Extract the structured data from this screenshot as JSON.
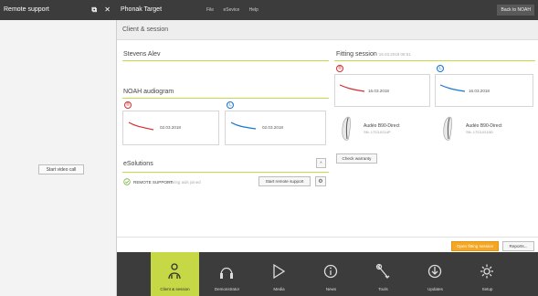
{
  "left_panel": {
    "title": "Remote support",
    "title_icons": "⧉ ✕",
    "start_video_label": "Start video call"
  },
  "app": {
    "title": "Phonak Target",
    "menu": [
      "File",
      "eSevice",
      "Help"
    ],
    "back_noah": "Back to NOAH",
    "subheader": "Client & session",
    "client_name": "Stevens Alev",
    "noah_audiogram": "NOAH audiogram",
    "audiogram_right_date": "02.03.2018",
    "audiogram_left_date": "02.03.2018",
    "fitting_session_label": "Fitting session",
    "fitting_session_datetime": "16.03.2018 08:51",
    "fitting_right_date": "16.03.2018",
    "fitting_left_date": "16.03.2018",
    "device_right_name": "Audéo B90-Direct",
    "device_right_sn": "SN: 1723-0214P",
    "device_left_name": "Audéo B90-Direct",
    "device_left_sn": "SN: 1723-0215D",
    "check_warranty": "Check warranty",
    "esolutions": "eSolutions",
    "remote_support": "REMOTE SUPPORT",
    "remote_support_status": "Hearing aids joined",
    "start_remote_support": "Start remote support",
    "open_fitting_session": "Open fitting session",
    "reports": "Reports..."
  },
  "nav": [
    {
      "label": "Client & session",
      "icon": "person-icon",
      "active": true
    },
    {
      "label": "Demonstrator",
      "icon": "headphones-icon",
      "active": false
    },
    {
      "label": "Media",
      "icon": "play-icon",
      "active": false
    },
    {
      "label": "News",
      "icon": "info-icon",
      "active": false
    },
    {
      "label": "Tools",
      "icon": "tools-icon",
      "active": false
    },
    {
      "label": "Updates",
      "icon": "download-icon",
      "active": false
    },
    {
      "label": "Setup",
      "icon": "gear-icon",
      "active": false
    }
  ],
  "colors": {
    "accent": "#c6d845",
    "orange_button": "#f5a623",
    "right_ear": "#d32f2f",
    "left_ear": "#1976d2",
    "dark_bar": "#3c3c3c"
  }
}
